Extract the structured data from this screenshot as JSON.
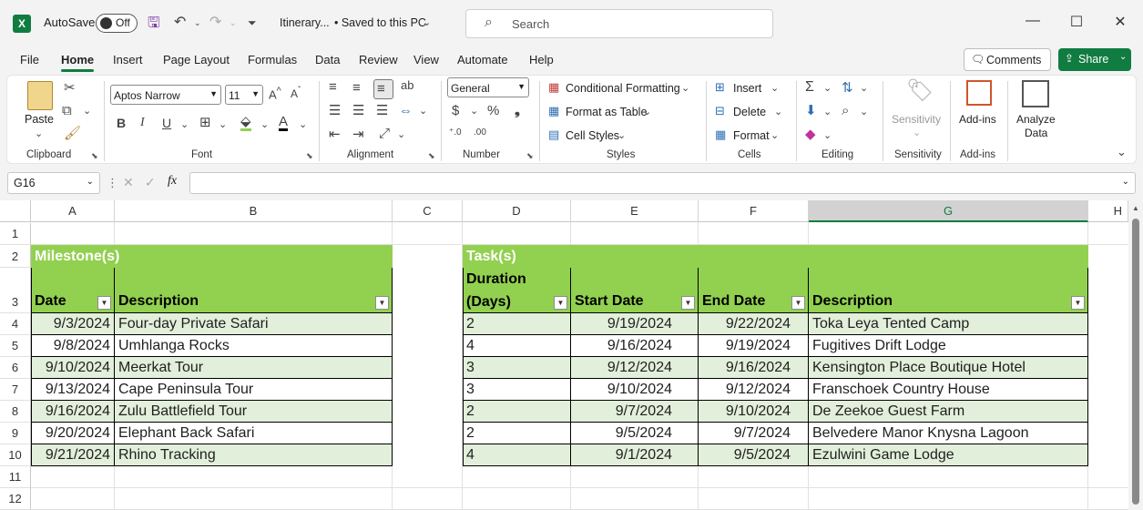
{
  "titlebar": {
    "autosave_label": "AutoSave",
    "autosave_state": "Off",
    "filename": "Itinerary...",
    "save_status": "• Saved to this PC",
    "search_placeholder": "Search"
  },
  "menu": {
    "tabs": [
      "File",
      "Home",
      "Insert",
      "Page Layout",
      "Formulas",
      "Data",
      "Review",
      "View",
      "Automate",
      "Help"
    ],
    "active": "Home",
    "comments": "Comments",
    "share": "Share"
  },
  "ribbon": {
    "clipboard": {
      "paste": "Paste",
      "label": "Clipboard"
    },
    "font": {
      "name": "Aptos Narrow",
      "size": "11",
      "label": "Font"
    },
    "alignment": {
      "label": "Alignment"
    },
    "number": {
      "format": "General",
      "label": "Number"
    },
    "styles": {
      "conditional": "Conditional Formatting",
      "format_table": "Format as Table",
      "cell_styles": "Cell Styles",
      "label": "Styles"
    },
    "cells": {
      "insert": "Insert",
      "delete": "Delete",
      "format": "Format",
      "label": "Cells"
    },
    "editing": {
      "label": "Editing"
    },
    "sensitivity": {
      "button": "Sensitivity",
      "label": "Sensitivity"
    },
    "addins": {
      "button": "Add-ins",
      "label": "Add-ins"
    },
    "analyze": {
      "line1": "Analyze",
      "line2": "Data"
    }
  },
  "formula_bar": {
    "name_box": "G16",
    "fx": "fx",
    "formula": ""
  },
  "grid": {
    "columns": [
      "A",
      "B",
      "C",
      "D",
      "E",
      "F",
      "G",
      "H"
    ],
    "rows": [
      "1",
      "2",
      "3",
      "4",
      "5",
      "6",
      "7",
      "8",
      "9",
      "10",
      "11",
      "12"
    ],
    "selected_column": "G"
  },
  "milestones": {
    "title": "Milestone(s)",
    "headers": [
      "Date",
      "Description"
    ],
    "rows": [
      [
        "9/3/2024",
        "Four-day Private Safari"
      ],
      [
        "9/8/2024",
        "Umhlanga Rocks"
      ],
      [
        "9/10/2024",
        "Meerkat Tour"
      ],
      [
        "9/13/2024",
        "Cape Peninsula Tour"
      ],
      [
        "9/16/2024",
        "Zulu Battlefield Tour"
      ],
      [
        "9/20/2024",
        "Elephant Back Safari"
      ],
      [
        "9/21/2024",
        "Rhino Tracking"
      ]
    ]
  },
  "tasks": {
    "title": "Task(s)",
    "headers": [
      "Duration",
      "(Days)",
      "Start Date",
      "End Date",
      "Description"
    ],
    "rows": [
      [
        "2",
        "9/19/2024",
        "9/22/2024",
        "Toka Leya Tented Camp"
      ],
      [
        "4",
        "9/16/2024",
        "9/19/2024",
        "Fugitives Drift Lodge"
      ],
      [
        "3",
        "9/12/2024",
        "9/16/2024",
        "Kensington Place Boutique Hotel"
      ],
      [
        "3",
        "9/10/2024",
        "9/12/2024",
        "Franschoek Country House"
      ],
      [
        "2",
        "9/7/2024",
        "9/10/2024",
        "De Zeekoe Guest Farm"
      ],
      [
        "2",
        "9/5/2024",
        "9/7/2024",
        "Belvedere Manor Knysna Lagoon"
      ],
      [
        "4",
        "9/1/2024",
        "9/5/2024",
        "Ezulwini Game Lodge"
      ]
    ]
  },
  "colors": {
    "accent": "#107c41",
    "table_header": "#92d050",
    "band": "#e2efda"
  }
}
